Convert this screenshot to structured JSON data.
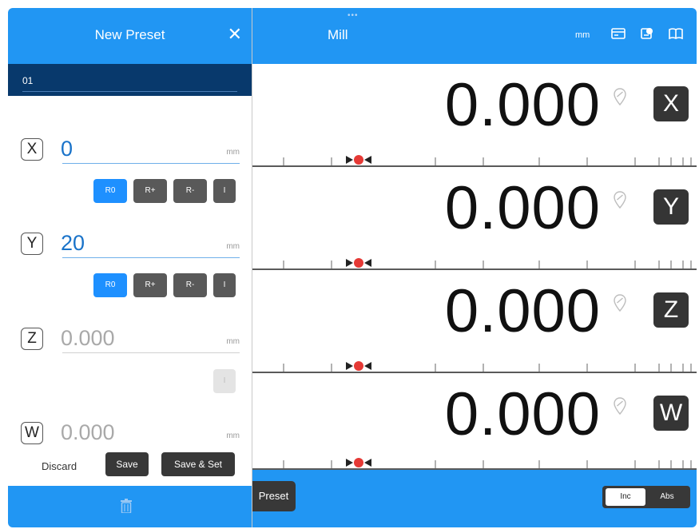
{
  "preset_panel": {
    "title": "New Preset",
    "name": "01",
    "axes": [
      {
        "label": "X",
        "value": "0",
        "unit": "mm",
        "modes": [
          "R0",
          "R+",
          "R-",
          "I"
        ]
      },
      {
        "label": "Y",
        "value": "20",
        "unit": "mm",
        "modes": [
          "R0",
          "R+",
          "R-",
          "I"
        ]
      },
      {
        "label": "Z",
        "value": "0.000",
        "unit": "mm",
        "modes": [
          "I"
        ]
      },
      {
        "label": "W",
        "value": "0.000",
        "unit": "mm"
      }
    ],
    "discard_label": "Discard",
    "save_label": "Save",
    "save_set_label": "Save & Set"
  },
  "main": {
    "title": "Mill",
    "unit": "mm",
    "axes": [
      {
        "label": "X",
        "value": "0.000"
      },
      {
        "label": "Y",
        "value": "0.000"
      },
      {
        "label": "Z",
        "value": "0.000"
      },
      {
        "label": "W",
        "value": "0.000"
      }
    ],
    "preset_label": "Preset",
    "toggle": {
      "inc": "Inc",
      "abs": "Abs",
      "selected": "Inc"
    }
  },
  "colors": {
    "accent": "#2196f3",
    "name_bar": "#08396c",
    "button_dark": "#383838",
    "selected_mode": "#1e90ff",
    "marker_red": "#e53935"
  }
}
